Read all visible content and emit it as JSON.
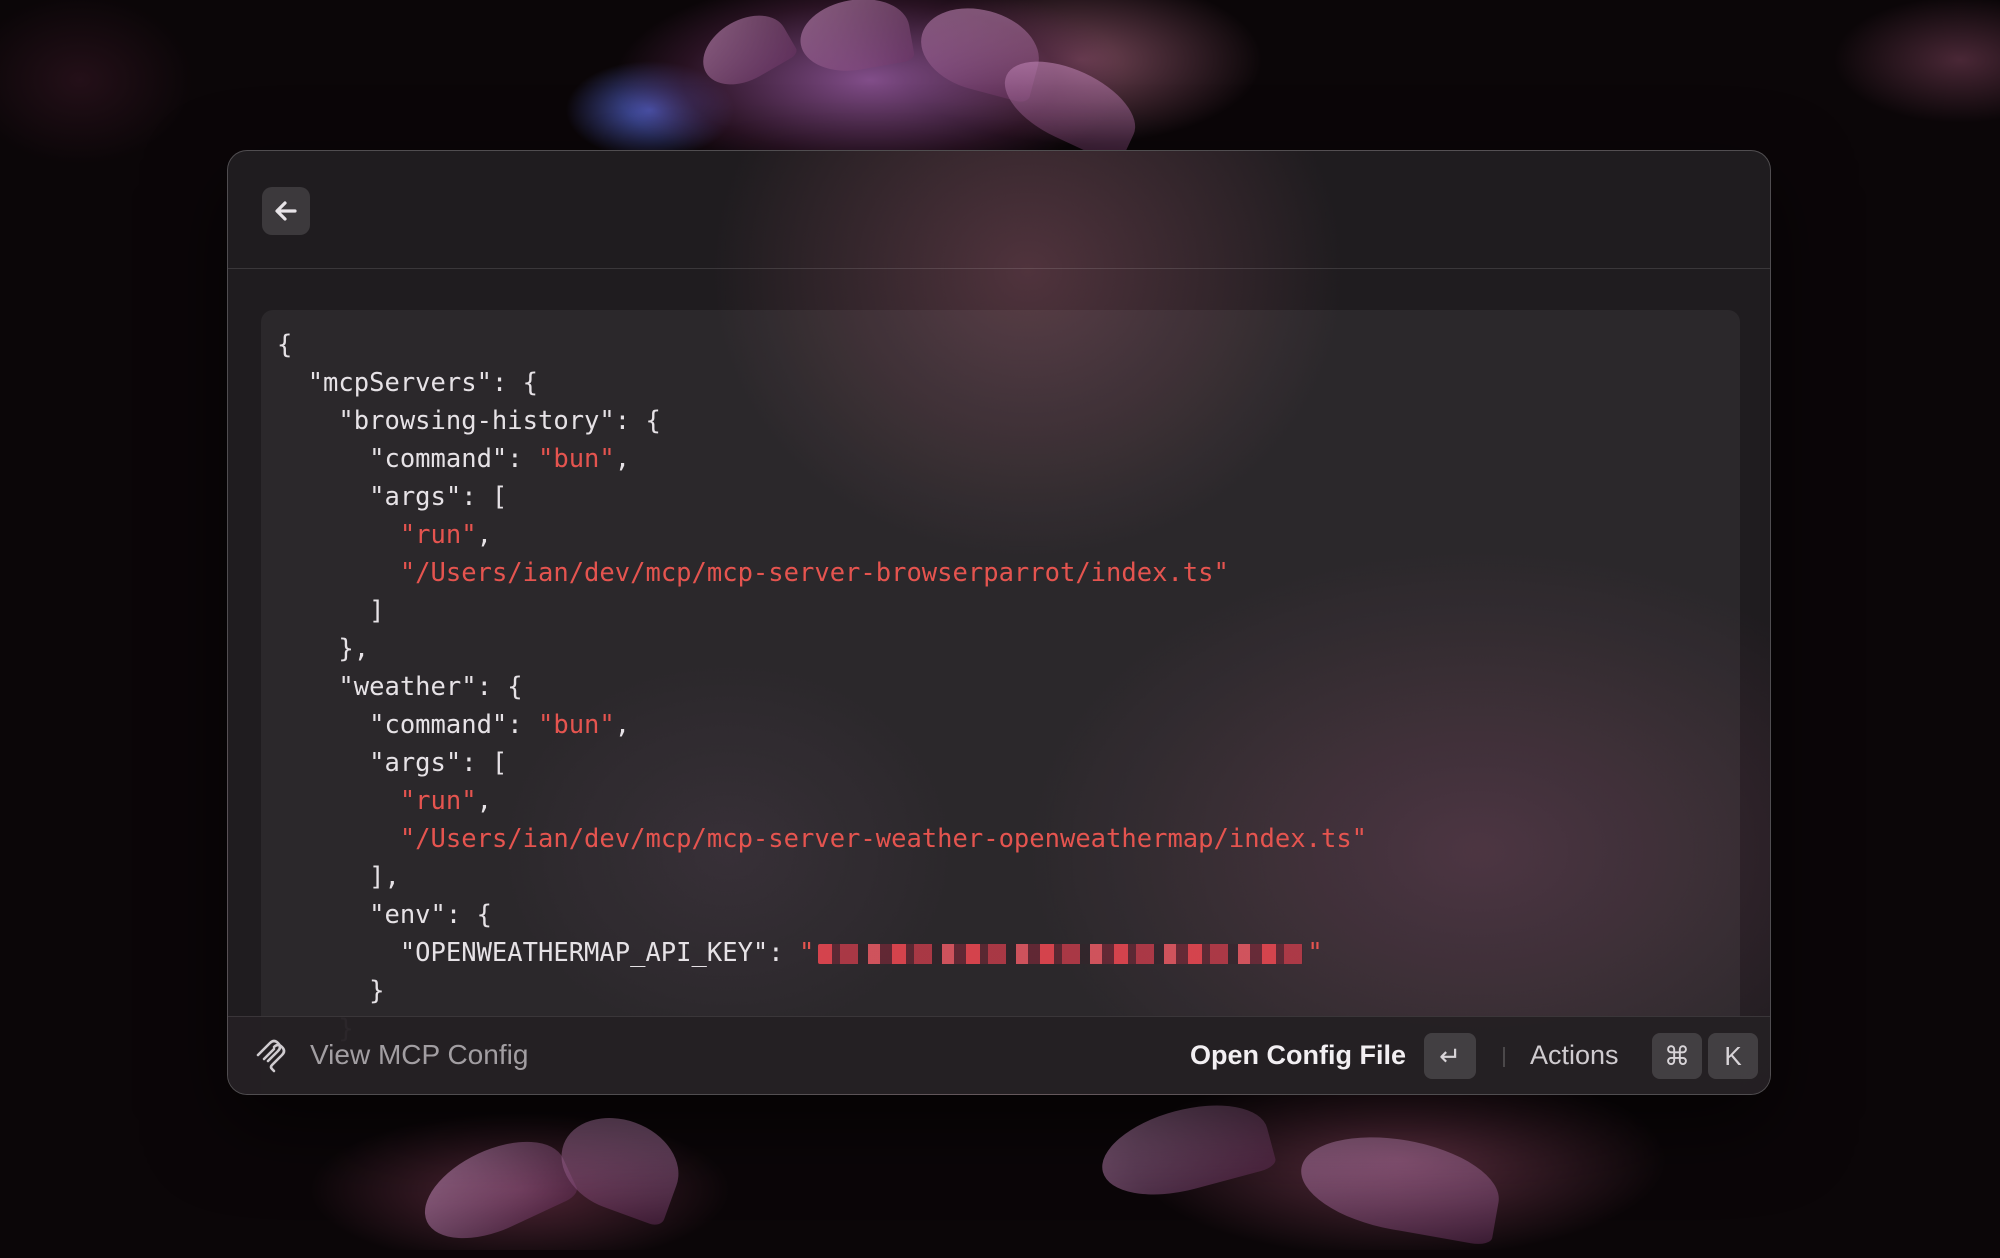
{
  "window": {
    "back_icon": "arrow-left-icon"
  },
  "code": {
    "lines": [
      [
        {
          "t": "p",
          "v": "{"
        }
      ],
      [
        {
          "t": "p",
          "v": "  \"mcpServers\": {"
        }
      ],
      [
        {
          "t": "p",
          "v": "    \"browsing-history\": {"
        }
      ],
      [
        {
          "t": "p",
          "v": "      \"command\": "
        },
        {
          "t": "s",
          "v": "\"bun\""
        },
        {
          "t": "p",
          "v": ","
        }
      ],
      [
        {
          "t": "p",
          "v": "      \"args\": ["
        }
      ],
      [
        {
          "t": "p",
          "v": "        "
        },
        {
          "t": "s",
          "v": "\"run\""
        },
        {
          "t": "p",
          "v": ","
        }
      ],
      [
        {
          "t": "p",
          "v": "        "
        },
        {
          "t": "s",
          "v": "\"/Users/ian/dev/mcp/mcp-server-browserparrot/index.ts\""
        }
      ],
      [
        {
          "t": "p",
          "v": "      ]"
        }
      ],
      [
        {
          "t": "p",
          "v": "    },"
        }
      ],
      [
        {
          "t": "p",
          "v": "    \"weather\": {"
        }
      ],
      [
        {
          "t": "p",
          "v": "      \"command\": "
        },
        {
          "t": "s",
          "v": "\"bun\""
        },
        {
          "t": "p",
          "v": ","
        }
      ],
      [
        {
          "t": "p",
          "v": "      \"args\": ["
        }
      ],
      [
        {
          "t": "p",
          "v": "        "
        },
        {
          "t": "s",
          "v": "\"run\""
        },
        {
          "t": "p",
          "v": ","
        }
      ],
      [
        {
          "t": "p",
          "v": "        "
        },
        {
          "t": "s",
          "v": "\"/Users/ian/dev/mcp/mcp-server-weather-openweathermap/index.ts\""
        }
      ],
      [
        {
          "t": "p",
          "v": "      ],"
        }
      ],
      [
        {
          "t": "p",
          "v": "      \"env\": {"
        }
      ],
      [
        {
          "t": "p",
          "v": "        \"OPENWEATHERMAP_API_KEY\": "
        },
        {
          "t": "s",
          "v": "\""
        },
        {
          "t": "r",
          "v": ""
        },
        {
          "t": "s",
          "v": "\""
        }
      ],
      [
        {
          "t": "p",
          "v": "      }"
        }
      ],
      [
        {
          "t": "p",
          "v": "    }"
        }
      ]
    ],
    "string_color": "#e5544f"
  },
  "footer": {
    "icon": "mcp-logo-icon",
    "title": "View MCP Config",
    "primary_action": "Open Config File",
    "enter_key": "↵",
    "actions_label": "Actions",
    "cmd_key": "⌘",
    "k_key": "K"
  }
}
